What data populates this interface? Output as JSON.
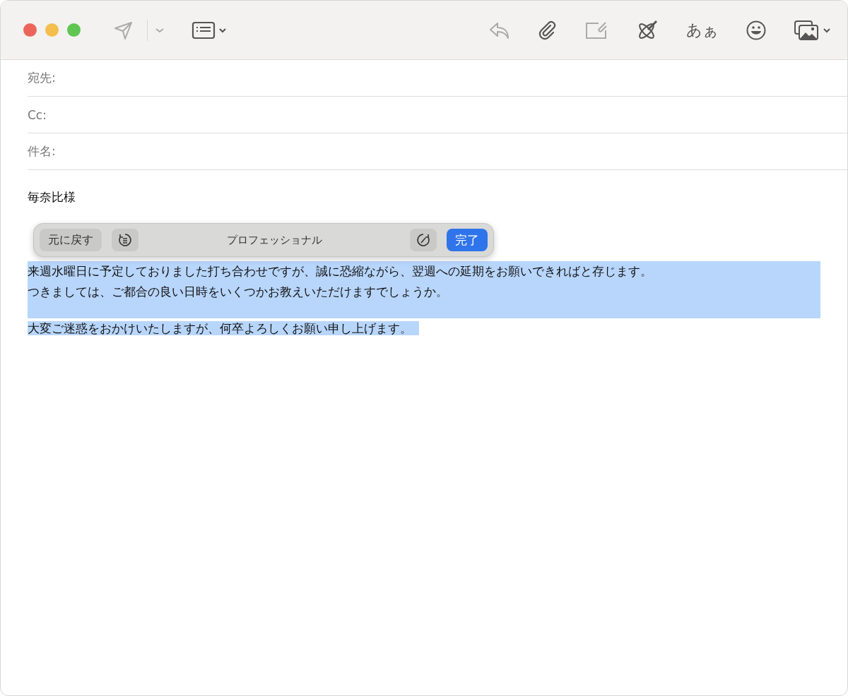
{
  "toolbar": {
    "left": [
      {
        "kind": "send",
        "disabled": true
      },
      {
        "kind": "send-menu",
        "disabled": true
      },
      {
        "kind": "header-fields",
        "disabled": false
      }
    ],
    "right": [
      {
        "kind": "reply",
        "disabled": true
      },
      {
        "kind": "attach",
        "disabled": false
      },
      {
        "kind": "markup",
        "disabled": true
      },
      {
        "kind": "writing-tools",
        "disabled": false
      },
      {
        "kind": "fonts",
        "label": "あぁ",
        "disabled": false
      },
      {
        "kind": "emoji",
        "disabled": false
      },
      {
        "kind": "photos",
        "disabled": false
      }
    ]
  },
  "fields": [
    {
      "label": "宛先:"
    },
    {
      "label": "Cc:"
    },
    {
      "label": "件名:"
    }
  ],
  "body": [
    {
      "text": "毎奈比様",
      "selected": false,
      "kind": "block"
    },
    {
      "text": "来週水曜日に予定しておりました打ち合わせですが、誠に恐縮ながら、翌週への延期をお願いできればと存じます。",
      "selected": true,
      "kind": "row"
    },
    {
      "text": "つきましては、ご都合の良い日時をいくつかお教えいただけますでしょうか。",
      "selected": true,
      "kind": "row"
    },
    {
      "text": "大変ご迷惑をおかけいたしますが、何卒よろしくお願い申し上げます。",
      "selected": true,
      "kind": "line"
    }
  ],
  "popup": {
    "revert": "元に戻す",
    "style": "プロフェッショナル",
    "done": "完了"
  }
}
